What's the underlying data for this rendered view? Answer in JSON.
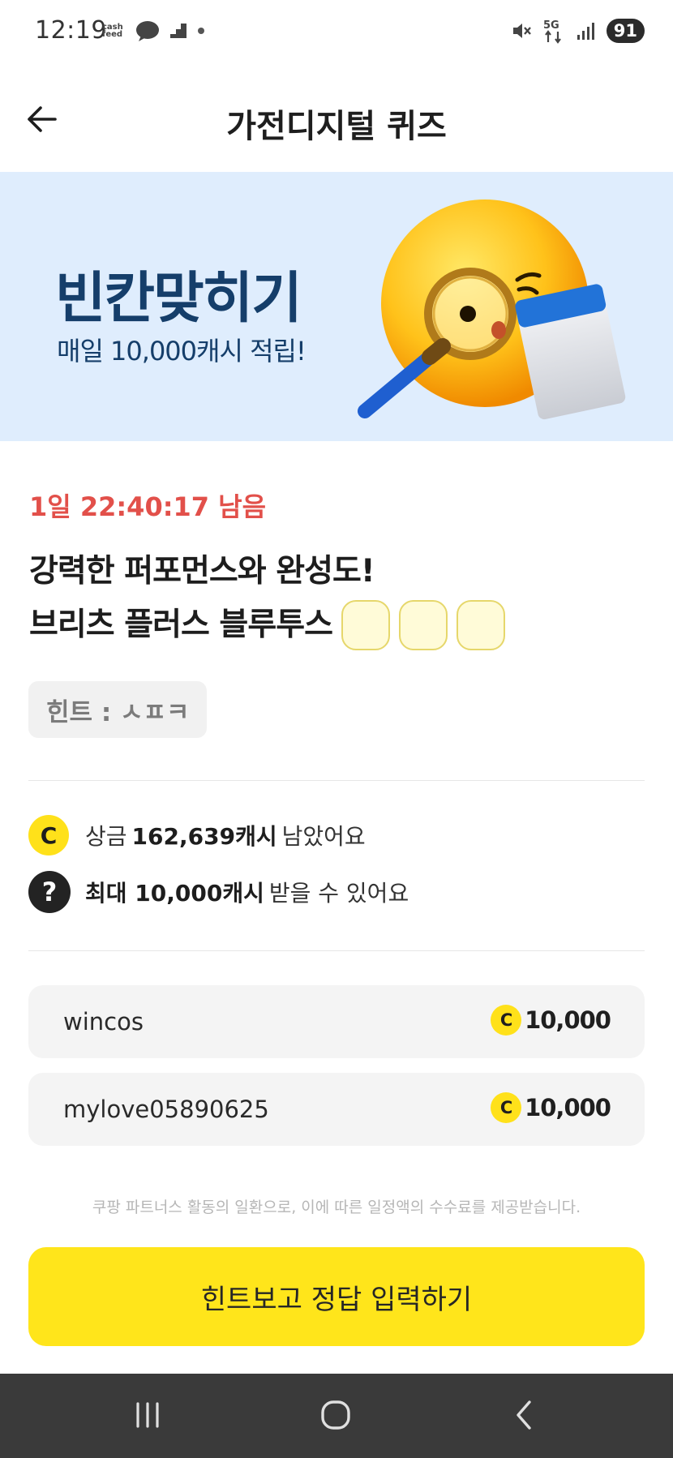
{
  "status_bar": {
    "time": "12:19",
    "notification_icons": [
      "cashfeed-icon",
      "chat-icon",
      "stairs-icon",
      "dot-icon"
    ],
    "cashfeed_text": "cash\nfeed",
    "network": "5G",
    "battery": "91"
  },
  "header": {
    "title": "가전디지털 퀴즈"
  },
  "banner": {
    "title": "빈칸맞히기",
    "subtitle": "매일 10,000캐시 적립!"
  },
  "quiz": {
    "timer": "1일 22:40:17 남음",
    "question_line1": "강력한 퍼포먼스와 완성도!",
    "question_line2": "브리츠 플러스 블루투스",
    "blank_count": 3,
    "hint": "힌트 : ㅅㅍㅋ"
  },
  "info": {
    "prize_prefix": "상금",
    "prize_amount": "162,639캐시",
    "prize_suffix": "남았어요",
    "max_prefix": "최대 10,000캐시",
    "max_suffix": "받을 수 있어요",
    "coin_letter": "C",
    "help_symbol": "?"
  },
  "winners": [
    {
      "name": "wincos",
      "amount": "10,000"
    },
    {
      "name": "mylove05890625",
      "amount": "10,000"
    }
  ],
  "disclaimer": "쿠팡 파트너스 활동의 일환으로, 이에 따른 일정액의 수수료를 제공받습니다.",
  "cta_label": "힌트보고 정답 입력하기",
  "colors": {
    "accent_yellow": "#ffe51b",
    "timer_red": "#e2504a",
    "banner_bg": "#dfedfd",
    "banner_text": "#153e6a"
  }
}
